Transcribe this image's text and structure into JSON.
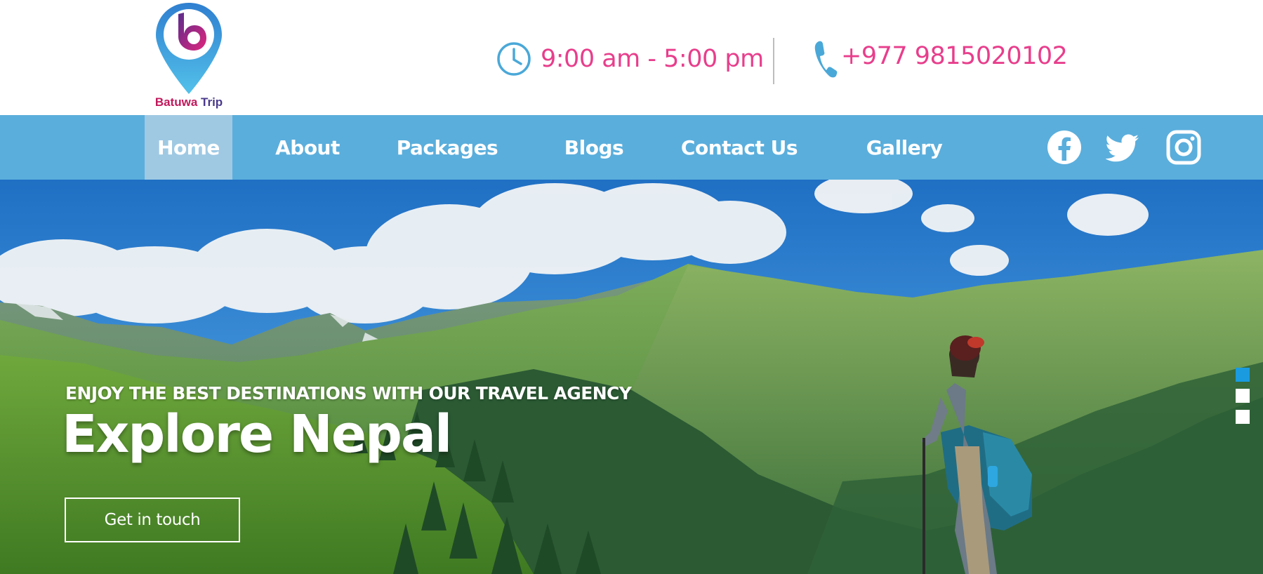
{
  "brand": {
    "name_part1": "Batuwa",
    "name_part2": "Trip",
    "logo_letter": "b",
    "colors": {
      "pink": "#e83e8c",
      "nav_blue": "#5aaedc",
      "active_tab": "#9fc9e3",
      "pin_blue": "#3b9fd8",
      "underline": "#e91e63"
    }
  },
  "contact": {
    "hours": "9:00 am - 5:00 pm",
    "hours_icon": "clock-icon",
    "phone": "+977 9815020102",
    "phone_icon": "phone-icon"
  },
  "nav": {
    "items": [
      {
        "label": "Home",
        "active": true
      },
      {
        "label": "About",
        "active": false
      },
      {
        "label": "Packages",
        "active": false
      },
      {
        "label": "Blogs",
        "active": false
      },
      {
        "label": "Contact Us",
        "active": false
      },
      {
        "label": "Gallery",
        "active": false
      }
    ],
    "social": [
      "facebook-icon",
      "twitter-icon",
      "instagram-icon"
    ]
  },
  "hero": {
    "subtitle": "ENJOY THE  BEST DESTINATIONS WITH OUR TRAVEL AGENCY",
    "title": "Explore Nepal",
    "cta": "Get in touch",
    "slides": {
      "count": 3,
      "active_index": 0
    }
  }
}
